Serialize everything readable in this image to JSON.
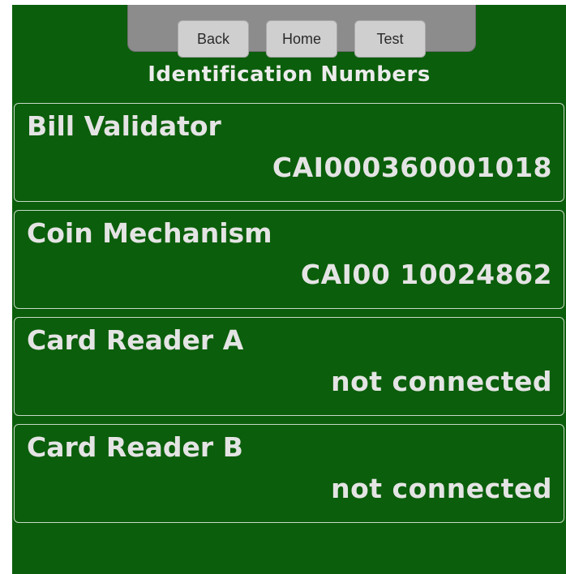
{
  "nav": {
    "back_label": "Back",
    "home_label": "Home",
    "test_label": "Test"
  },
  "page_title": "Identification Numbers",
  "devices": [
    {
      "label": "Bill Validator",
      "value": "CAI000360001018"
    },
    {
      "label": "Coin Mechanism",
      "value": "CAI00 10024862"
    },
    {
      "label": "Card Reader A",
      "value": "not connected"
    },
    {
      "label": "Card Reader B",
      "value": "not connected"
    }
  ],
  "colors": {
    "background": "#0b5e0b",
    "text": "#e4e4e4",
    "nav_bar": "#8c8c8c",
    "nav_button": "#cfcfcf"
  }
}
